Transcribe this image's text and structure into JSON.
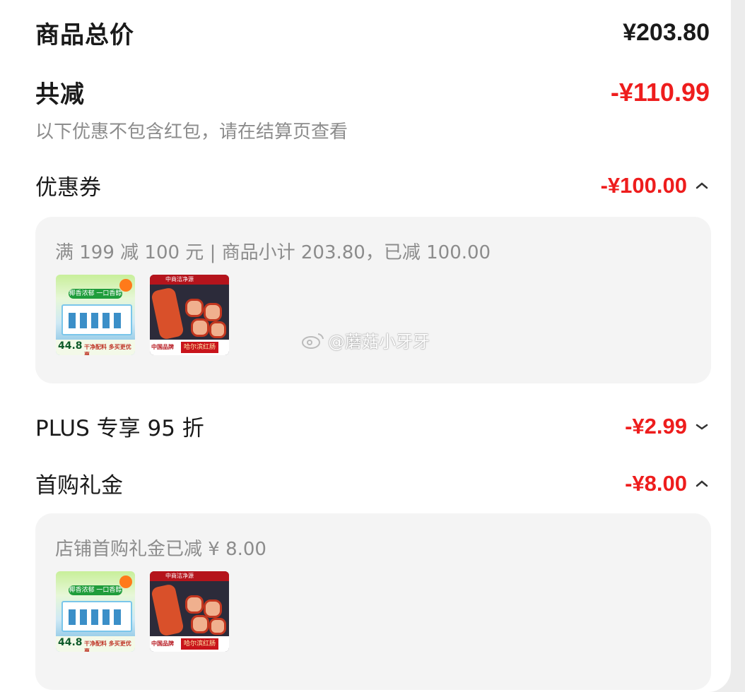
{
  "summary": {
    "total_label": "商品总价",
    "total_value": "¥203.80",
    "reduce_label": "共减",
    "reduce_value": "-¥110.99",
    "reduce_note": "以下优惠不包含红包，请在结算页查看"
  },
  "coupon": {
    "label": "优惠券",
    "value": "-¥100.00",
    "chevron": "chevron-up-icon",
    "detail": "满 199 减 100 元 | 商品小计 203.80，已减 100.00",
    "products": [
      {
        "badge": "44.8",
        "top_text": "椰香浓郁 一口香醇",
        "bottom_text": "干净配料 多买更优惠"
      },
      {
        "top_text": "中商洁净源",
        "bottom_text": "哈尔滨红肠",
        "tag": "中国品牌"
      }
    ]
  },
  "plus": {
    "label": "PLUS 专享 95 折",
    "value": "-¥2.99",
    "chevron": "chevron-down-icon"
  },
  "first_buy": {
    "label": "首购礼金",
    "value": "-¥8.00",
    "chevron": "chevron-up-icon",
    "detail": "店铺首购礼金已减 ¥ 8.00",
    "products": [
      {
        "badge": "44.8",
        "top_text": "椰香浓郁 一口香醇",
        "bottom_text": "干净配料 多买更优惠"
      },
      {
        "top_text": "中商洁净源",
        "bottom_text": "哈尔滨红肠",
        "tag": "中国品牌"
      }
    ]
  },
  "watermark": "@蘑菇小牙牙",
  "colors": {
    "red": "#ee1d1d",
    "muted": "#8c8c8c"
  }
}
